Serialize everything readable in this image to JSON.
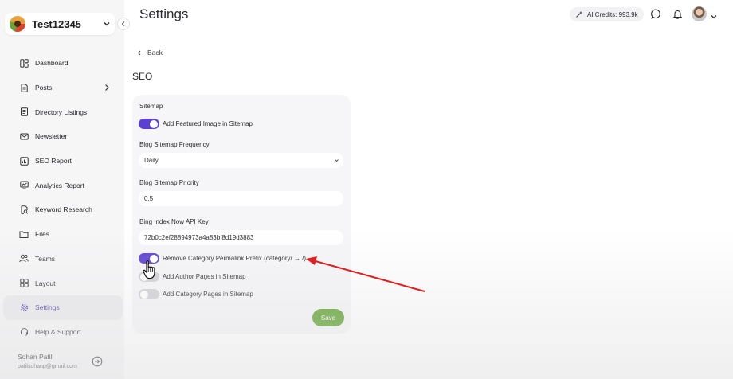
{
  "workspace": {
    "name": "Test12345"
  },
  "sidebar": {
    "items": [
      {
        "label": "Dashboard"
      },
      {
        "label": "Posts"
      },
      {
        "label": "Directory Listings"
      },
      {
        "label": "Newsletter"
      },
      {
        "label": "SEO Report"
      },
      {
        "label": "Analytics Report"
      },
      {
        "label": "Keyword Research"
      },
      {
        "label": "Files"
      },
      {
        "label": "Teams"
      },
      {
        "label": "Layout"
      },
      {
        "label": "Settings",
        "active": true
      },
      {
        "label": "Help & Support"
      }
    ],
    "user": {
      "name": "Sohan Patil",
      "email": "patilsohanp@gmail.com"
    }
  },
  "header": {
    "title": "Settings",
    "credits": "AI Credits: 993.9k"
  },
  "content": {
    "back": "Back",
    "section": "SEO",
    "sitemap_heading": "Sitemap",
    "toggles": {
      "featured_image": {
        "label": "Add Featured Image in Sitemap",
        "on": true
      },
      "remove_category_prefix": {
        "label": "Remove Category Permalink Prefix (category/ → /)",
        "on": true
      },
      "author_pages": {
        "label": "Add Author Pages in Sitemap",
        "on": false
      },
      "category_pages": {
        "label": "Add Category Pages in Sitemap",
        "on": false
      }
    },
    "frequency": {
      "label": "Blog Sitemap Frequency",
      "value": "Daily"
    },
    "priority": {
      "label": "Blog Sitemap Priority",
      "value": "0.5"
    },
    "bing": {
      "label": "Bing Index Now API Key",
      "value": "72b0c2ef28894973a4a83bf8d19d3883"
    },
    "save": "Save"
  },
  "colors": {
    "accent": "#5c3fd3",
    "save": "#5ca12b",
    "annotation_arrow": "#e02020"
  }
}
